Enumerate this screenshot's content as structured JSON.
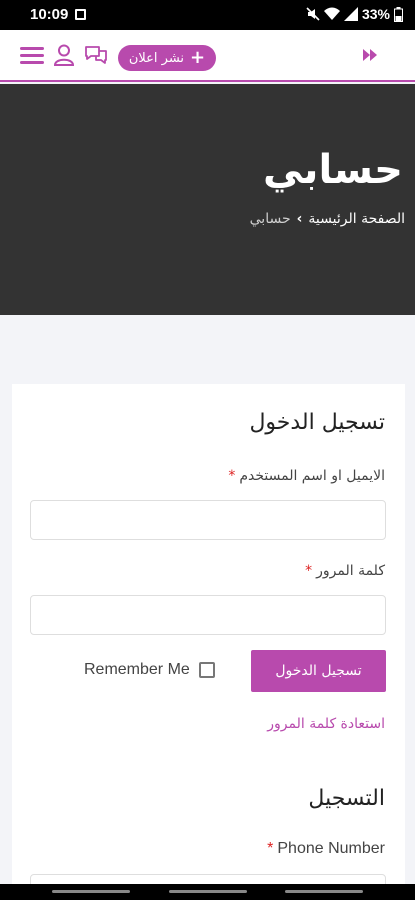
{
  "status_bar": {
    "time": "10:09",
    "battery": "33%",
    "icons": [
      "image-icon",
      "mute-icon",
      "wifi-icon",
      "signal-icon",
      "battery-icon"
    ]
  },
  "header": {
    "post_ad_label": "نشر اعلان",
    "icons": [
      "menu-icon",
      "user-icon",
      "chat-icon",
      "logo-icon"
    ],
    "accent": "#b84aad"
  },
  "hero": {
    "title": "حسابي",
    "breadcrumb_home": "الصفحة الرئيسية",
    "breadcrumb_separator": "›",
    "breadcrumb_current": "حسابي",
    "background": "#333333"
  },
  "login": {
    "title": "تسجيل الدخول",
    "username_label": "الايميل او اسم المستخدم",
    "password_label": "كلمة المرور",
    "required_mark": "*",
    "username_value": "",
    "password_value": "",
    "submit_label": "تسجيل الدخول",
    "remember_label": "Remember Me",
    "remember_checked": false,
    "forgot_label": "استعادة كلمة المرور"
  },
  "register": {
    "title": "التسجيل",
    "phone_label": "Phone Number",
    "required_mark": "*"
  }
}
